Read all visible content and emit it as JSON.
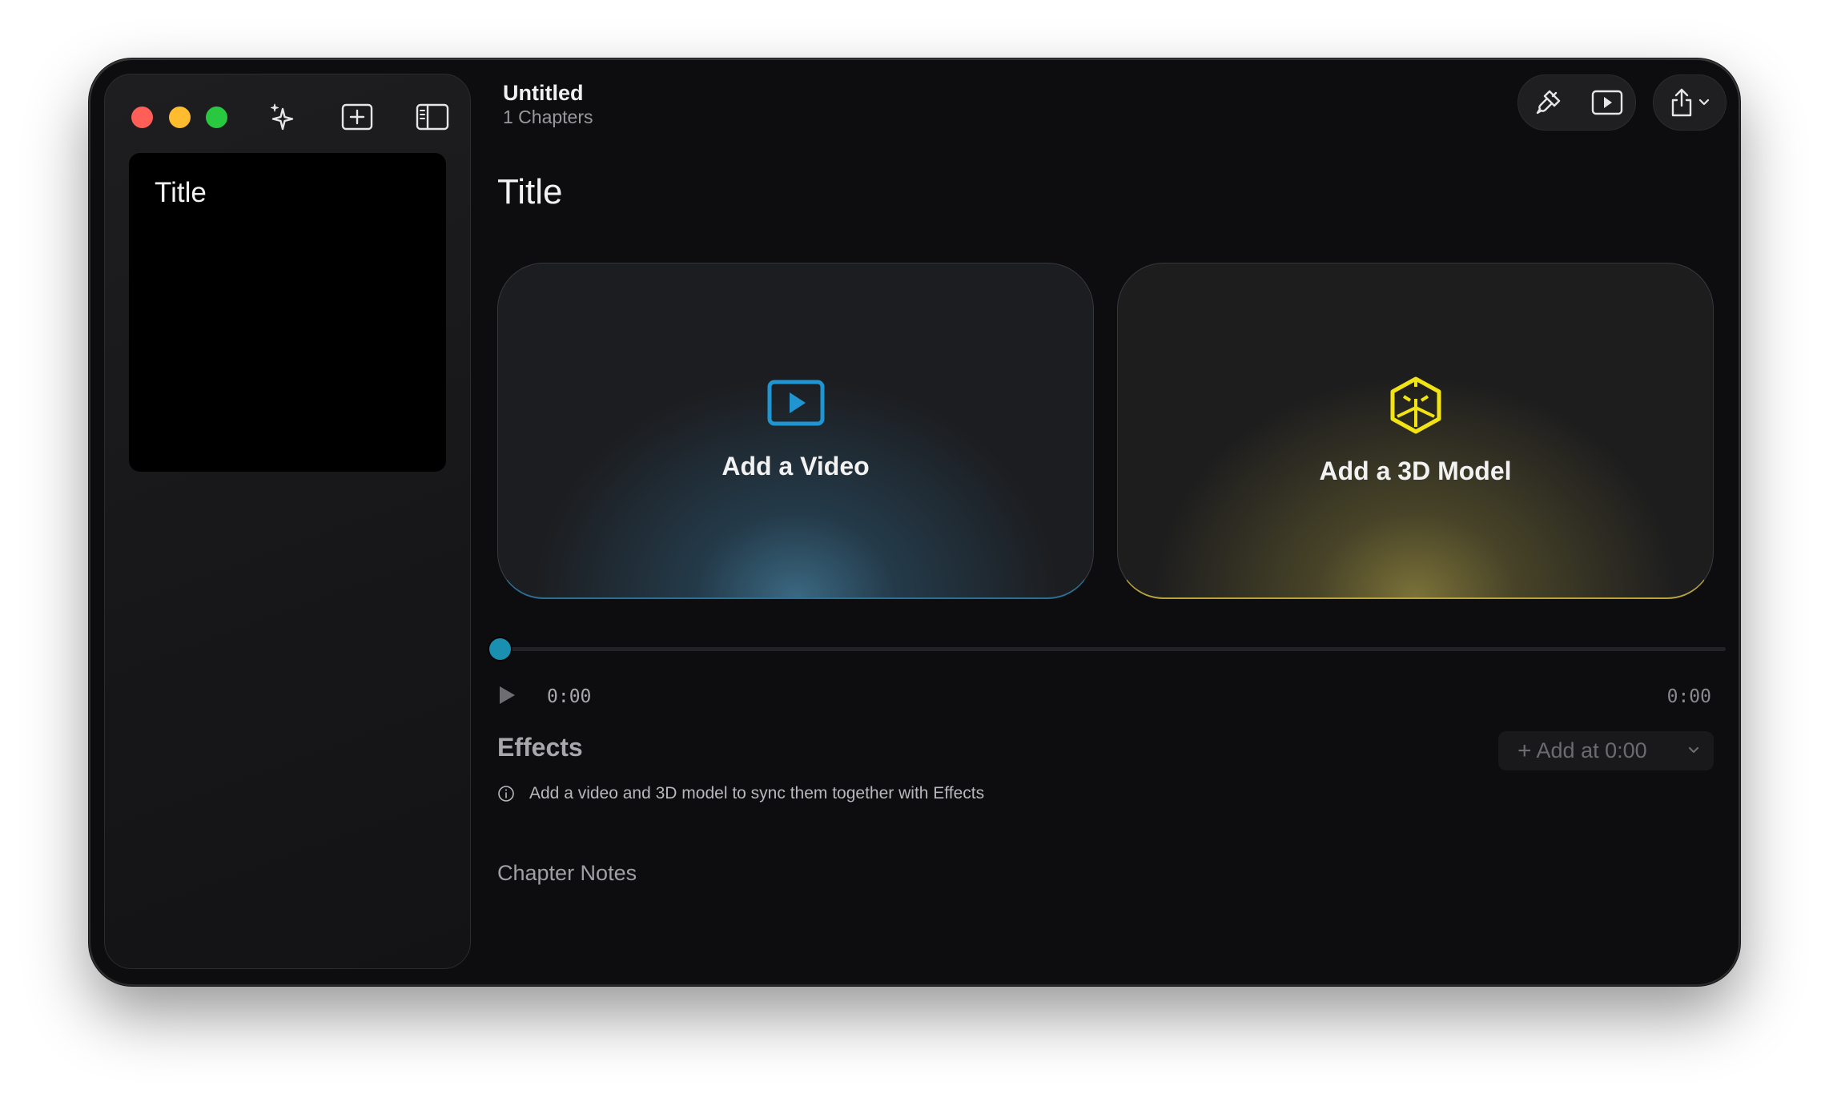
{
  "window": {
    "title": "Untitled",
    "subtitle": "1 Chapters"
  },
  "toolbar": {
    "left_icons": [
      "sparkles-icon",
      "add-chapter-icon",
      "sidebar-toggle-icon"
    ],
    "right_icons": [
      "paintbrush-icon",
      "preview-play-icon",
      "share-icon",
      "chevron-down-icon"
    ]
  },
  "sidebar": {
    "chapters": [
      {
        "title": "Title"
      }
    ]
  },
  "main": {
    "chapter_title": "Title",
    "cards": {
      "video": {
        "label": "Add a Video",
        "icon": "video-play-icon",
        "accent": "#1f95d1"
      },
      "model": {
        "label": "Add a 3D Model",
        "icon": "cube-3d-icon",
        "accent": "#f2e413"
      }
    },
    "timeline": {
      "current_time": "0:00",
      "end_time": "0:00",
      "progress": 0,
      "accent": "#1a8fb0"
    },
    "effects": {
      "title": "Effects",
      "add_button": "Add at 0:00",
      "info_text": "Add a video and 3D model to sync them together with Effects"
    },
    "notes": {
      "title": "Chapter Notes"
    }
  },
  "colors": {
    "traffic_close": "#ff5f57",
    "traffic_minimize": "#febc2e",
    "traffic_maximize": "#28c840",
    "background": "#0d0d0f"
  }
}
